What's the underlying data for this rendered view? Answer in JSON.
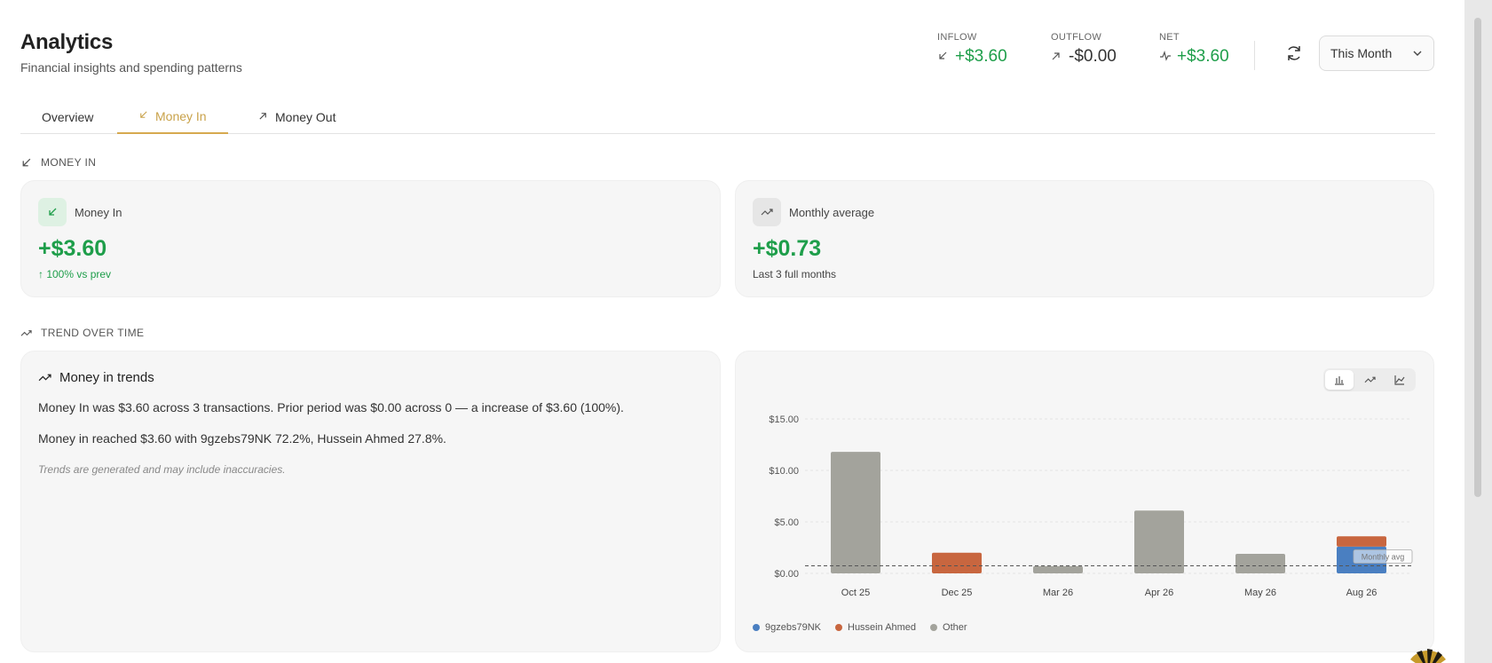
{
  "page": {
    "title": "Analytics",
    "subtitle": "Financial insights and spending patterns"
  },
  "stats": {
    "inflow": {
      "label": "INFLOW",
      "value": "+$3.60"
    },
    "outflow": {
      "label": "OUTFLOW",
      "value": "-$0.00"
    },
    "net": {
      "label": "NET",
      "value": "+$3.60"
    }
  },
  "period": {
    "selected": "This Month"
  },
  "tabs": [
    {
      "label": "Overview",
      "active": false
    },
    {
      "label": "Money In",
      "active": true
    },
    {
      "label": "Money Out",
      "active": false
    }
  ],
  "sections": {
    "money_in": "MONEY IN",
    "trend": "TREND OVER TIME"
  },
  "kpi": {
    "money_in": {
      "label": "Money In",
      "value": "+$3.60",
      "sub": "↑ 100% vs prev"
    },
    "monthly_avg": {
      "label": "Monthly average",
      "value": "+$0.73",
      "sub": "Last 3 full months"
    }
  },
  "trends": {
    "title": "Money in trends",
    "p1": "Money In was $3.60 across 3 transactions. Prior period was $0.00 across 0 — a increase of $3.60 (100%).",
    "p2": "Money in reached $3.60 with 9gzebs79NK 72.2%, Hussein Ahmed 27.8%.",
    "note": "Trends are generated and may include inaccuracies."
  },
  "chart_data": {
    "type": "bar",
    "stacked": true,
    "categories": [
      "Oct 25",
      "Dec 25",
      "Mar 26",
      "Apr 26",
      "May 26",
      "Aug 26"
    ],
    "series": [
      {
        "name": "9gzebs79NK",
        "color": "#4a7fc1",
        "values": [
          0,
          0,
          0,
          0,
          0,
          2.6
        ]
      },
      {
        "name": "Hussein Ahmed",
        "color": "#c8663f",
        "values": [
          0,
          2.0,
          0,
          0,
          0,
          1.0
        ]
      },
      {
        "name": "Other",
        "color": "#a3a39c",
        "values": [
          11.8,
          0,
          0.7,
          6.1,
          1.9,
          0
        ]
      }
    ],
    "yticks": [
      "$0.00",
      "$5.00",
      "$10.00",
      "$15.00"
    ],
    "ylim": [
      0,
      15
    ],
    "reference_line": {
      "label": "Monthly avg",
      "value": 0.73
    },
    "grid": true,
    "legend_position": "bottom-left"
  }
}
